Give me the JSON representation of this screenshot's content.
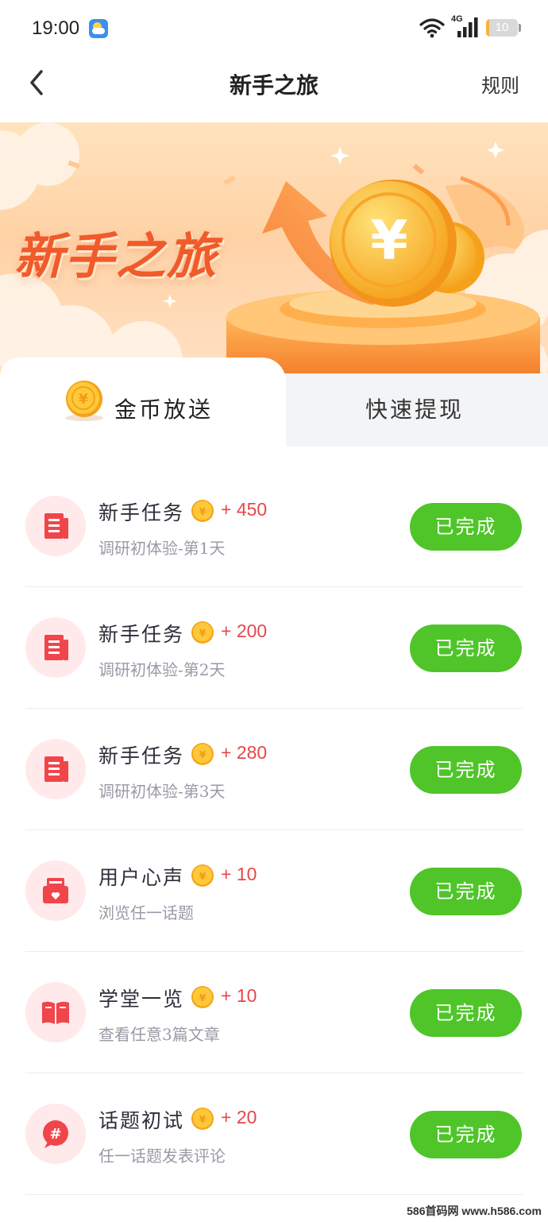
{
  "status_bar": {
    "time": "19:00",
    "weather_icon": "weather-icon",
    "network": "4G",
    "battery": "10",
    "battery_level": 0.1
  },
  "nav": {
    "title": "新手之旅",
    "rules_label": "规则",
    "back_icon": "chevron-left-icon"
  },
  "banner": {
    "title": "新手之旅",
    "colors": {
      "title": "#f15a2b",
      "background": "#ffd2a6",
      "coin": "#f9b826"
    }
  },
  "tabs": [
    {
      "label": "金币放送",
      "active": true,
      "icon": "coin-icon"
    },
    {
      "label": "快速提现",
      "active": false
    }
  ],
  "tasks": [
    {
      "name": "新手任务",
      "reward": "+ 450",
      "desc": "调研初体验-第1天",
      "status": "已完成",
      "icon": "document-icon"
    },
    {
      "name": "新手任务",
      "reward": "+ 200",
      "desc": "调研初体验-第2天",
      "status": "已完成",
      "icon": "document-icon"
    },
    {
      "name": "新手任务",
      "reward": "+ 280",
      "desc": "调研初体验-第3天",
      "status": "已完成",
      "icon": "document-icon"
    },
    {
      "name": "用户心声",
      "reward": "+ 10",
      "desc": "浏览任一话题",
      "status": "已完成",
      "icon": "mailbox-heart-icon"
    },
    {
      "name": "学堂一览",
      "reward": "+ 10",
      "desc": "查看任意3篇文章",
      "status": "已完成",
      "icon": "open-book-icon"
    },
    {
      "name": "话题初试",
      "reward": "+ 20",
      "desc": "任一话题发表评论",
      "status": "已完成",
      "icon": "hashtag-bubble-icon"
    }
  ],
  "colors": {
    "done_button": "#4fc52a",
    "reward": "#e8464a",
    "icon_bg": "#ffe9ea",
    "icon_fg": "#f0454b"
  },
  "watermark": "586首码网 www.h586.com"
}
